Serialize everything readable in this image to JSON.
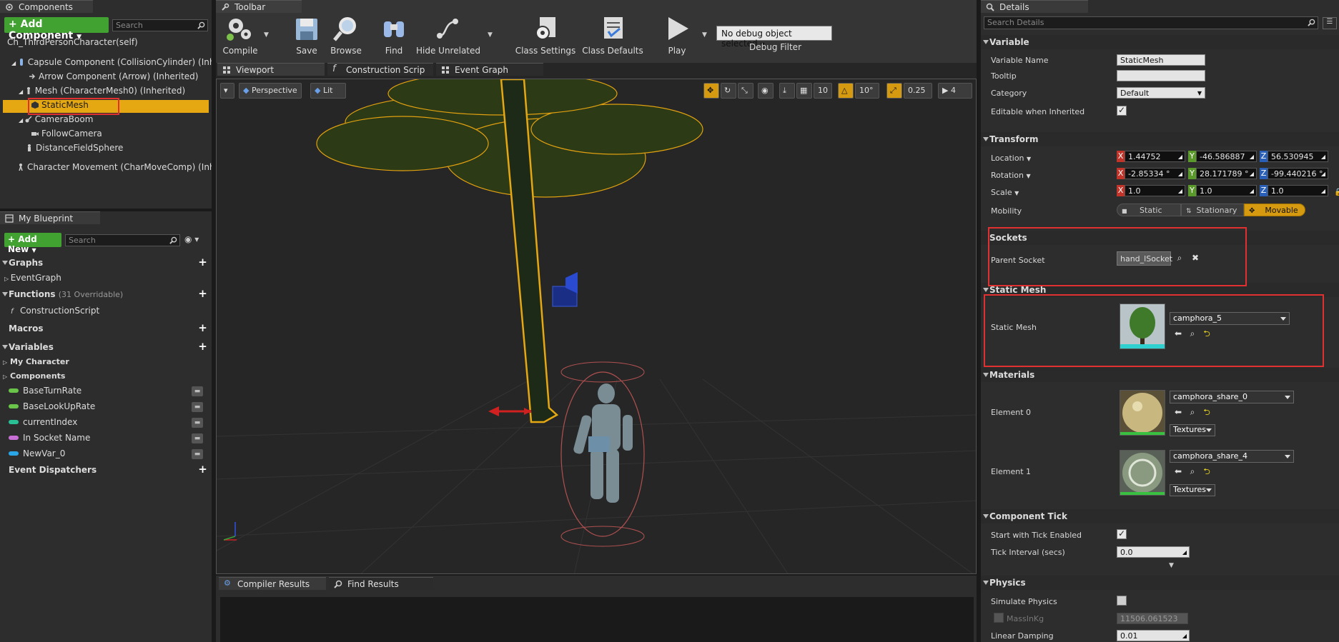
{
  "components_panel": {
    "tab_label": "Components",
    "add_component_label": "Add Component",
    "search_placeholder": "Search",
    "tree": [
      {
        "label": "Ch_ThirdPersonCharacter(self)"
      },
      {
        "label": "Capsule Component (CollisionCylinder) (Inherit"
      },
      {
        "label": "Arrow Component (Arrow) (Inherited)"
      },
      {
        "label": "Mesh (CharacterMesh0) (Inherited)"
      },
      {
        "label": "StaticMesh"
      },
      {
        "label": "CameraBoom"
      },
      {
        "label": "FollowCamera"
      },
      {
        "label": "DistanceFieldSphere"
      },
      {
        "label": "Character Movement (CharMoveComp) (Inherit"
      }
    ]
  },
  "blueprint_panel": {
    "tab_label": "My Blueprint",
    "add_new_label": "Add New",
    "search_placeholder": "Search",
    "graphs_label": "Graphs",
    "event_graph_label": "EventGraph",
    "functions_label": "Functions",
    "functions_note": "(31 Overridable)",
    "construction_script_label": "ConstructionScript",
    "macros_label": "Macros",
    "variables_label": "Variables",
    "my_character_label": "My Character",
    "components_label": "Components",
    "variables": [
      {
        "name": "BaseTurnRate",
        "color": "#6ac44a"
      },
      {
        "name": "BaseLookUpRate",
        "color": "#6ac44a"
      },
      {
        "name": "currentIndex",
        "color": "#29c095"
      },
      {
        "name": "In Socket Name",
        "color": "#c86fd6"
      },
      {
        "name": "NewVar_0",
        "color": "#2aa5e8"
      }
    ],
    "event_dispatchers_label": "Event Dispatchers"
  },
  "toolbar": {
    "tab_label": "Toolbar",
    "compile": "Compile",
    "save": "Save",
    "browse": "Browse",
    "find": "Find",
    "hide_unrelated": "Hide Unrelated",
    "class_settings": "Class Settings",
    "class_defaults": "Class Defaults",
    "play": "Play",
    "debug_object": "No debug object selected",
    "debug_filter": "Debug Filter"
  },
  "editor_tabs": {
    "viewport": "Viewport",
    "construction_script": "Construction Scrip",
    "event_graph": "Event Graph"
  },
  "viewport": {
    "perspective": "Perspective",
    "lit": "Lit",
    "grid_snap": "10",
    "rotation_snap": "10°",
    "scale_snap": "0.25",
    "camera_speed": "4"
  },
  "bottom_tabs": {
    "compiler_results": "Compiler Results",
    "find_results": "Find Results"
  },
  "details": {
    "tab_label": "Details",
    "search_placeholder": "Search Details",
    "variable_section": "Variable",
    "variable_name_label": "Variable Name",
    "variable_name_value": "StaticMesh",
    "tooltip_label": "Tooltip",
    "tooltip_value": "",
    "category_label": "Category",
    "category_value": "Default",
    "editable_label": "Editable when Inherited",
    "transform_section": "Transform",
    "location_label": "Location",
    "location": {
      "x": "1.44752",
      "y": "-46.586887",
      "z": "56.530945"
    },
    "rotation_label": "Rotation",
    "rotation": {
      "x": "-2.85334 °",
      "y": "28.171789 °",
      "z": "-99.440216 °"
    },
    "scale_label": "Scale",
    "scale": {
      "x": "1.0",
      "y": "1.0",
      "z": "1.0"
    },
    "mobility_label": "Mobility",
    "mobility_static": "Static",
    "mobility_stationary": "Stationary",
    "mobility_movable": "Movable",
    "sockets_section": "Sockets",
    "parent_socket_label": "Parent Socket",
    "parent_socket_value": "hand_lSocket",
    "static_mesh_section": "Static Mesh",
    "static_mesh_label": "Static Mesh",
    "static_mesh_value": "camphora_5",
    "materials_section": "Materials",
    "element0_label": "Element 0",
    "element0_value": "camphora_share_0",
    "element1_label": "Element 1",
    "element1_value": "camphora_share_4",
    "textures_label": "Textures",
    "component_tick_section": "Component Tick",
    "tick_enabled_label": "Start with Tick Enabled",
    "tick_interval_label": "Tick Interval (secs)",
    "tick_interval_value": "0.0",
    "physics_section": "Physics",
    "simulate_physics_label": "Simulate Physics",
    "mass_label": "MassInKg",
    "mass_value": "11506.061523",
    "linear_damping_label": "Linear Damping",
    "linear_damping_value": "0.01"
  },
  "colors": {
    "accent": "#e5a812",
    "highlight_box": "#e03030",
    "add_button": "#41a232",
    "axis_x": "#c0342a",
    "axis_y": "#5a9a2a",
    "axis_z": "#2a5fb8"
  }
}
